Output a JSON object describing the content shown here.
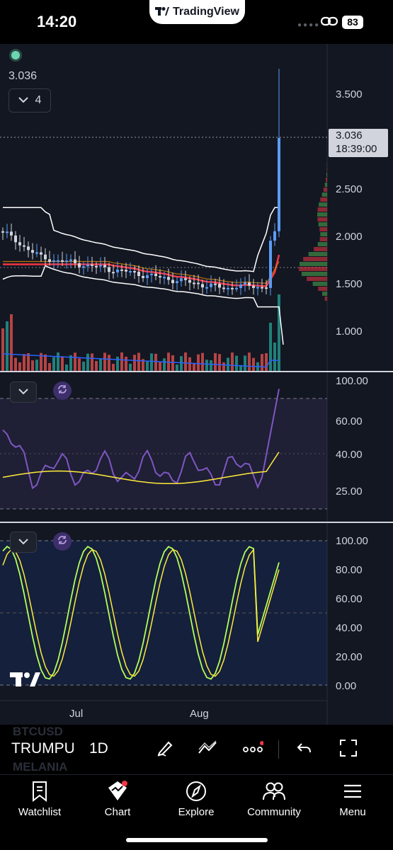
{
  "status_bar": {
    "time": "14:20",
    "battery": "83",
    "app_pill": "TradingView"
  },
  "legend": {
    "last_price": "3.036",
    "collapsed_count": "4"
  },
  "price_axis": {
    "ticks": [
      "3.500",
      "2.500",
      "2.000",
      "1.500",
      "1.000"
    ]
  },
  "price_tag": {
    "price": "3.036",
    "countdown": "18:39:00"
  },
  "rsi_axis": {
    "ticks": [
      "100.00",
      "60.00",
      "40.00",
      "25.00"
    ]
  },
  "stoch_axis": {
    "ticks": [
      "100.00",
      "80.00",
      "60.00",
      "40.00",
      "20.00",
      "0.00"
    ]
  },
  "time_axis": {
    "labels": [
      "Jul",
      "Aug"
    ]
  },
  "symbol_bar": {
    "symbol": "TRUMPUSD",
    "interval": "1D",
    "ghost_above": "BTCUSD",
    "ghost_below": "MELANIA"
  },
  "tabs": [
    {
      "label": "Watchlist",
      "icon": "bookmark-icon"
    },
    {
      "label": "Chart",
      "icon": "chart-icon"
    },
    {
      "label": "Explore",
      "icon": "compass-icon"
    },
    {
      "label": "Community",
      "icon": "people-icon"
    },
    {
      "label": "Menu",
      "icon": "hamburger-icon"
    }
  ],
  "colors": {
    "background": "#131722",
    "up": "#5b9cf6",
    "down": "#d1d4dc",
    "ema": "#f23645",
    "rsi": "#7e57c2",
    "stoch_k": "#b2ff59",
    "stoch_d": "#ffeb3b",
    "volume_up": "#26a69a",
    "volume_down": "#ef5350"
  }
}
